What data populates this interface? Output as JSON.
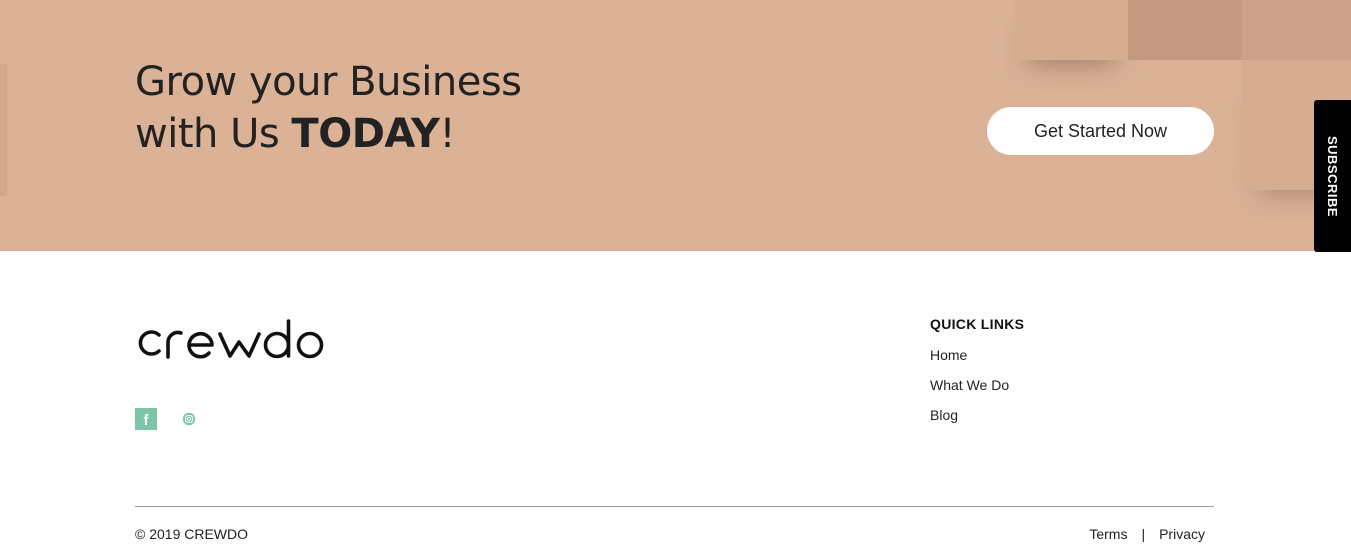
{
  "cta": {
    "title_line1": "Grow your Business",
    "title_line2_prefix": "with Us ",
    "title_line2_bold": "TODAY",
    "title_line2_suffix": "!",
    "button_label": "Get Started Now",
    "background_color": "#dbb296"
  },
  "subscribe_tab": {
    "label": "SUBSCRIBE"
  },
  "footer": {
    "logo_text": "crewdo",
    "social": [
      {
        "icon": "facebook-icon",
        "glyph": "f",
        "color": "#7cc5a8"
      },
      {
        "icon": "instagram-icon",
        "color": "#7cc5a8"
      }
    ],
    "quick_links": {
      "title": "QUICK LINKS",
      "items": [
        "Home",
        "What We Do",
        "Blog"
      ]
    },
    "copyright": "© 2019 CREWDO",
    "legal": {
      "terms": "Terms",
      "separator": "|",
      "privacy": "Privacy"
    }
  }
}
